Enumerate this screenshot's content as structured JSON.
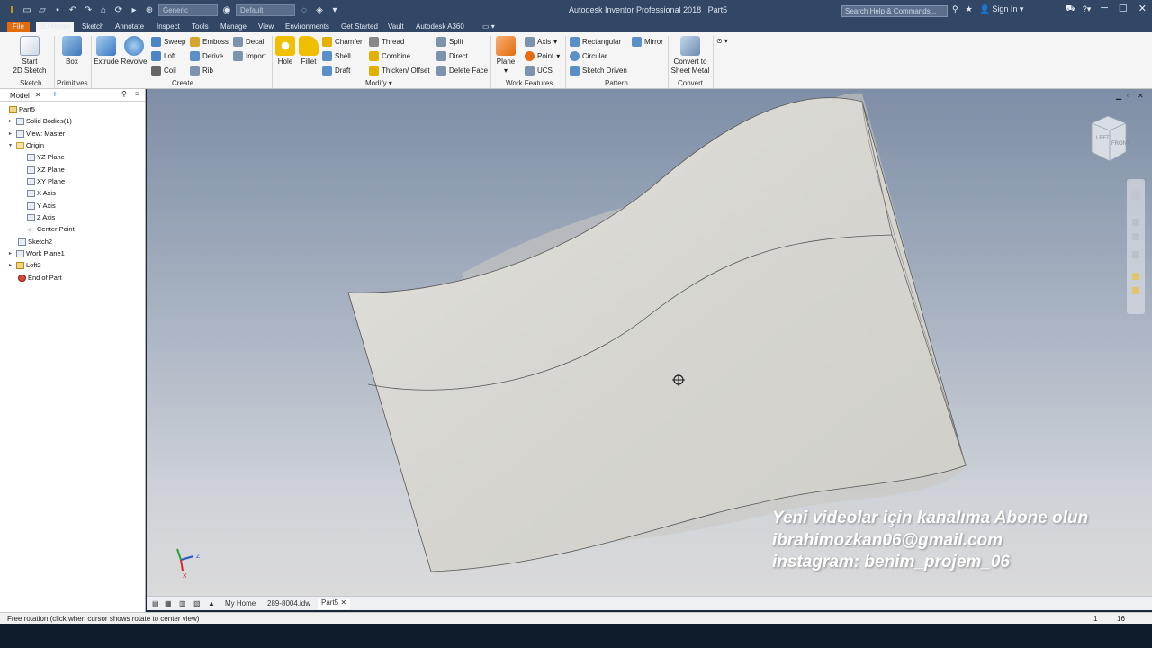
{
  "title_bar": {
    "app_title": "Autodesk Inventor Professional 2018",
    "doc_name": "Part5",
    "material": "Generic",
    "appearance": "Default",
    "search_placeholder": "Search Help & Commands...",
    "sign_in": "Sign In"
  },
  "tabs": [
    "File",
    "3D Model",
    "Sketch",
    "Annotate",
    "Inspect",
    "Tools",
    "Manage",
    "View",
    "Environments",
    "Get Started",
    "Vault",
    "Autodesk A360"
  ],
  "ribbon": {
    "sketch": {
      "group": "Sketch",
      "start": "Start",
      "start2": "2D Sketch"
    },
    "primitives": {
      "group": "Primitives",
      "box": "Box"
    },
    "create": {
      "group": "Create",
      "extrude": "Extrude",
      "revolve": "Revolve",
      "sweep": "Sweep",
      "loft": "Loft",
      "coil": "Coil",
      "emboss": "Emboss",
      "derive": "Derive",
      "rib": "Rib",
      "decal": "Decal",
      "import": "Import"
    },
    "modify": {
      "group": "Modify",
      "hole": "Hole",
      "fillet": "Fillet",
      "chamfer": "Chamfer",
      "shell": "Shell",
      "draft": "Draft",
      "thread": "Thread",
      "combine": "Combine",
      "thicken": "Thicken/ Offset",
      "split": "Split",
      "direct": "Direct",
      "delete_face": "Delete Face"
    },
    "work_features": {
      "group": "Work Features",
      "plane": "Plane",
      "axis": "Axis",
      "point": "Point",
      "ucs": "UCS"
    },
    "pattern": {
      "group": "Pattern",
      "rectangular": "Rectangular",
      "circular": "Circular",
      "sketch_driven": "Sketch Driven",
      "mirror": "Mirror"
    },
    "convert": {
      "group": "Convert",
      "label1": "Convert to",
      "label2": "Sheet Metal"
    }
  },
  "browser": {
    "tab": "Model",
    "items": {
      "part": "Part5",
      "solid": "Solid Bodies(1)",
      "view": "View: Master",
      "origin": "Origin",
      "yz": "YZ Plane",
      "xz": "XZ Plane",
      "xy": "XY Plane",
      "xaxis": "X Axis",
      "yaxis": "Y Axis",
      "zaxis": "Z Axis",
      "center": "Center Point",
      "sketch2": "Sketch2",
      "workplane": "Work Plane1",
      "loft": "Loft2",
      "end": "End of Part"
    }
  },
  "watermark": {
    "line1": "Yeni videolar için kanalıma Abone olun",
    "line2": "ibrahimozkan06@gmail.com",
    "line3": "instagram: benim_projem_06"
  },
  "doc_tabs": {
    "home": "My Home",
    "drawing": "289-8004.idw",
    "part": "Part5"
  },
  "status": {
    "text": "Free rotation (click when cursor shows rotate to center view)",
    "num1": "1",
    "num2": "16"
  },
  "viewcube": {
    "left": "LEFT",
    "front": "FRONT"
  },
  "triad": {
    "z": "Z",
    "x": "X"
  },
  "colors": {
    "title_bg": "#324766",
    "file_tab": "#e36c0a",
    "ribbon_bg": "#f5f5f5",
    "surface": "#dcdbd5"
  }
}
